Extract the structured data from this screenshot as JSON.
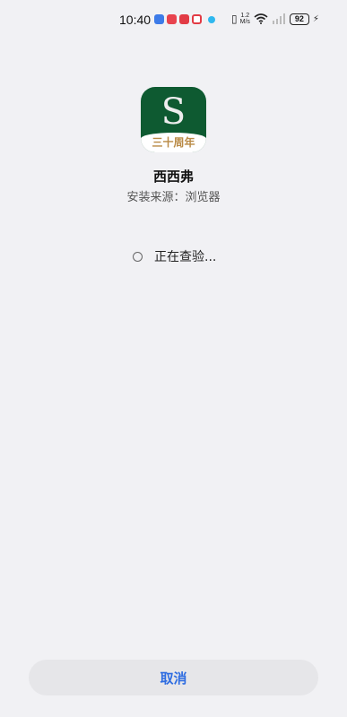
{
  "status_bar": {
    "time": "10:40",
    "net_speed_top": "1.2",
    "net_speed_bottom": "M/s",
    "battery": "92"
  },
  "app": {
    "name": "西西弗",
    "source": "安装来源：浏览器",
    "icon_letter": "S",
    "icon_banner": "三十周年",
    "icon_bg_color": "#0E5A31",
    "icon_banner_text_color": "#B98A45"
  },
  "status": {
    "checking_text": "正在查验..."
  },
  "actions": {
    "cancel_label": "取消",
    "accent_color": "#2F6DE1"
  }
}
